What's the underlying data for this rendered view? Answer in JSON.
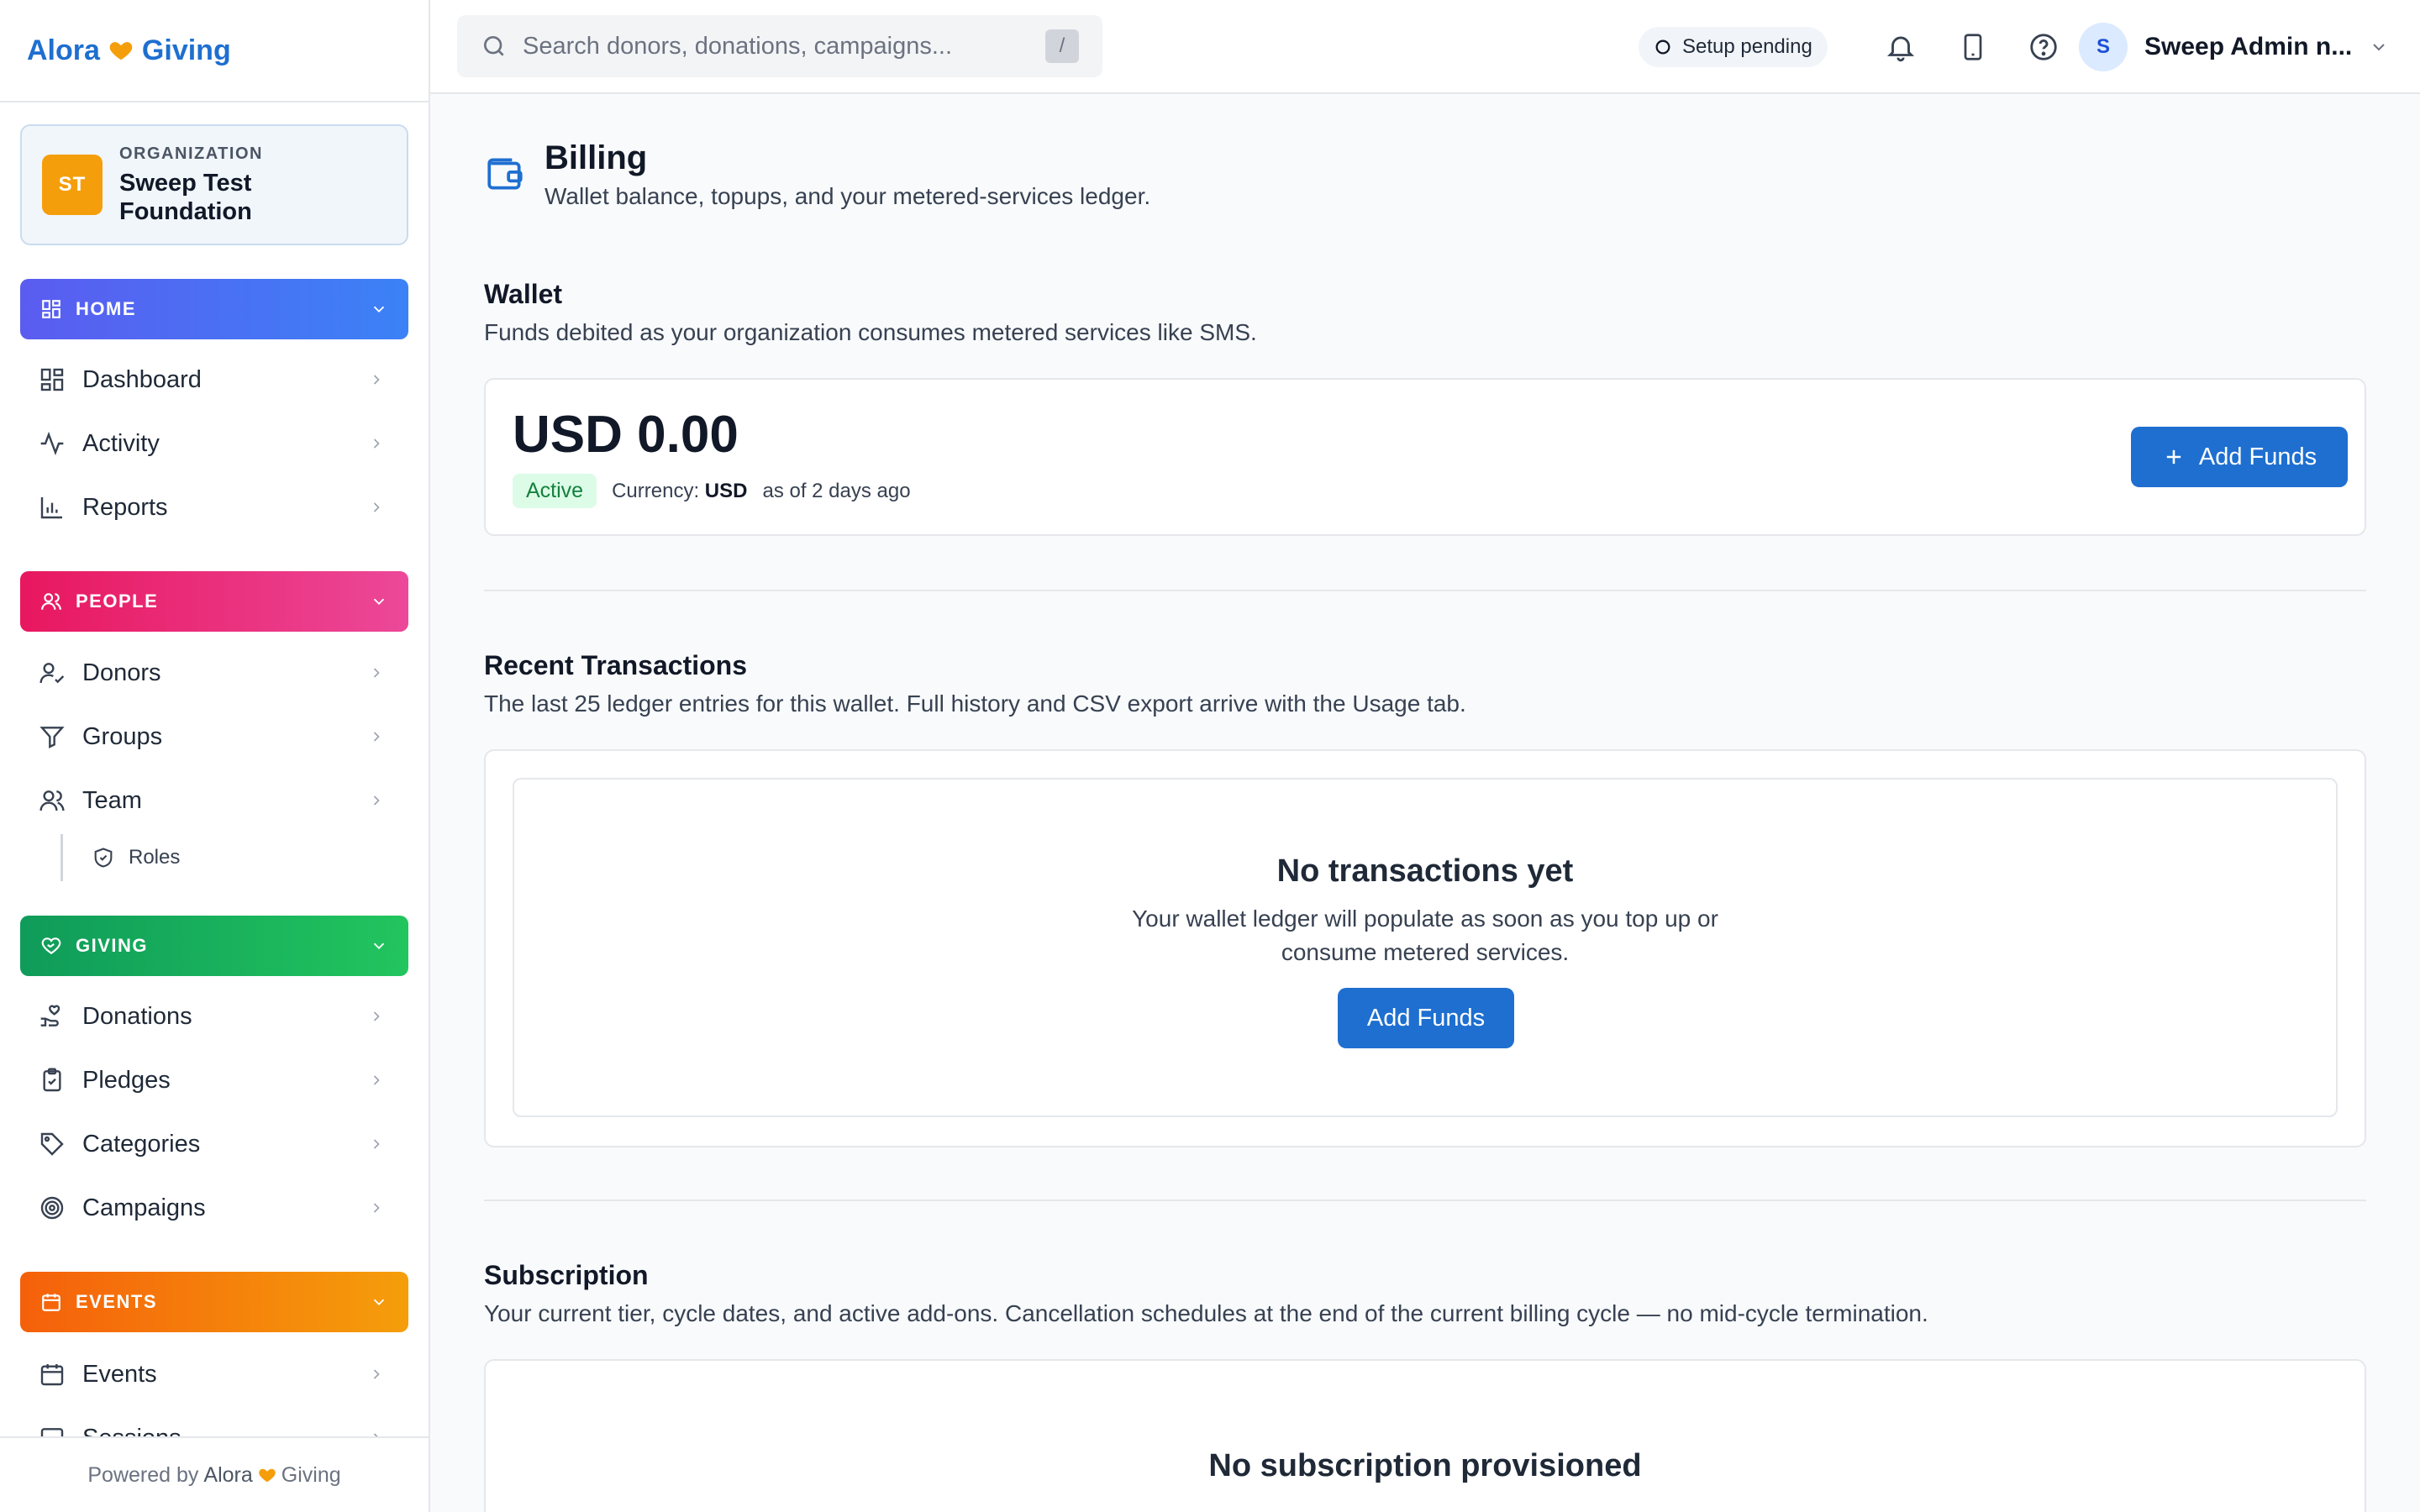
{
  "brand": {
    "name_left": "Alora",
    "name_right": "Giving",
    "accent": "#f59e0b",
    "primary": "#1e6fd0"
  },
  "organization": {
    "kicker": "ORGANIZATION",
    "name": "Sweep Test Foundation",
    "initials": "ST"
  },
  "sidebar": {
    "home": {
      "label": "HOME",
      "items": [
        {
          "label": "Dashboard",
          "icon": "dashboard-icon"
        },
        {
          "label": "Activity",
          "icon": "activity-icon"
        },
        {
          "label": "Reports",
          "icon": "reports-icon"
        }
      ]
    },
    "people": {
      "label": "PEOPLE",
      "items": [
        {
          "label": "Donors",
          "icon": "donors-icon"
        },
        {
          "label": "Groups",
          "icon": "filter-icon"
        },
        {
          "label": "Team",
          "icon": "team-icon"
        }
      ],
      "sub": {
        "label": "Roles",
        "icon": "shield-icon"
      }
    },
    "giving": {
      "label": "GIVING",
      "items": [
        {
          "label": "Donations",
          "icon": "donations-icon"
        },
        {
          "label": "Pledges",
          "icon": "clipboard-icon"
        },
        {
          "label": "Categories",
          "icon": "tag-icon"
        },
        {
          "label": "Campaigns",
          "icon": "target-icon"
        }
      ]
    },
    "events": {
      "label": "EVENTS",
      "items": [
        {
          "label": "Events",
          "icon": "calendar-icon"
        },
        {
          "label": "Sessions",
          "icon": "sessions-icon"
        }
      ]
    },
    "powered_by": "Powered by"
  },
  "topbar": {
    "search_placeholder": "Search donors, donations, campaigns...",
    "search_shortcut": "/",
    "setup_status": "Setup pending",
    "user_initial": "S",
    "user_name": "Sweep Admin n..."
  },
  "page": {
    "title": "Billing",
    "subtitle": "Wallet balance, topups, and your metered-services ledger."
  },
  "wallet": {
    "title": "Wallet",
    "description": "Funds debited as your organization consumes metered services like SMS.",
    "balance": "USD 0.00",
    "status": "Active",
    "currency_label": "Currency:",
    "currency": "USD",
    "as_of": "as of 2 days ago",
    "add_funds": "Add Funds"
  },
  "transactions": {
    "title": "Recent Transactions",
    "description": "The last 25 ledger entries for this wallet. Full history and CSV export arrive with the Usage tab.",
    "empty_title": "No transactions yet",
    "empty_desc": "Your wallet ledger will populate as soon as you top up or consume metered services.",
    "add_funds": "Add Funds"
  },
  "subscription": {
    "title": "Subscription",
    "description": "Your current tier, cycle dates, and active add-ons. Cancellation schedules at the end of the current billing cycle — no mid-cycle termination.",
    "empty_title": "No subscription provisioned"
  }
}
